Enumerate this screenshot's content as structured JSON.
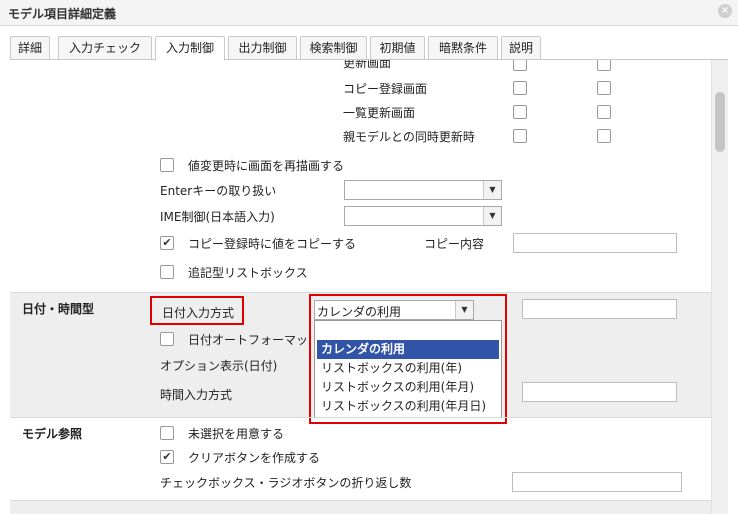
{
  "window": {
    "title": "モデル項目詳細定義",
    "close_icon": "×"
  },
  "tabs": [
    {
      "label": "詳細"
    },
    {
      "label": "入力チェック"
    },
    {
      "label": "入力制御"
    },
    {
      "label": "出力制御"
    },
    {
      "label": "検索制御"
    },
    {
      "label": "初期値"
    },
    {
      "label": "暗黙条件"
    },
    {
      "label": "説明"
    }
  ],
  "active_tab": "入力制御",
  "screen_rows": [
    {
      "label": "更新画面"
    },
    {
      "label": "コピー登録画面"
    },
    {
      "label": "一覧更新画面"
    },
    {
      "label": "親モデルとの同時更新時"
    }
  ],
  "options": {
    "redraw_label": "値変更時に画面を再描画する",
    "enter_label": "Enterキーの取り扱い",
    "ime_label": "IME制御(日本語入力)",
    "copy_value_label": "コピー登録時に値をコピーする",
    "copy_content_label": "コピー内容",
    "append_list_label": "追記型リストボックス"
  },
  "datetime_section": {
    "title": "日付・時間型",
    "date_input_label": "日付入力方式",
    "date_input_value": "カレンダの利用",
    "auto_format_label": "日付オートフォーマット",
    "option_display_label": "オプション表示(日付)",
    "time_input_label": "時間入力方式",
    "dropdown_options": [
      "カレンダの利用",
      "リストボックスの利用(年)",
      "リストボックスの利用(年月)",
      "リストボックスの利用(年月日)"
    ],
    "selected_option": "カレンダの利用"
  },
  "model_ref_section": {
    "title": "モデル参照",
    "unselected_label": "未選択を用意する",
    "clear_button_label": "クリアボタンを作成する",
    "wrap_label": "チェックボックス・ラジオボタンの折り返し数"
  },
  "checkbox_states": {
    "copy_value": true,
    "clear_button": true
  },
  "colors": {
    "highlight_red": "#e00000",
    "selection_blue": "#3254a8"
  }
}
